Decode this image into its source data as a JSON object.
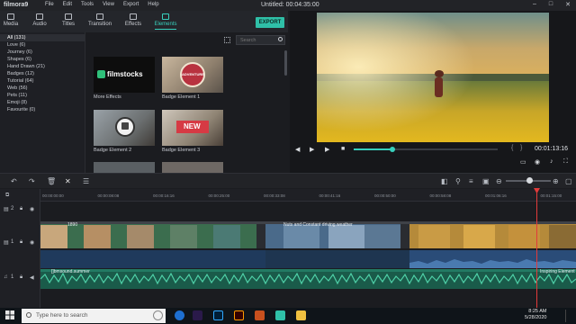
{
  "app": {
    "name": "filmora9",
    "title": "Untitled: 00:04:35:00",
    "menu": [
      "File",
      "Edit",
      "Tools",
      "View",
      "Export",
      "Help"
    ]
  },
  "tabs": [
    "Media",
    "Audio",
    "Titles",
    "Transition",
    "Effects",
    "Elements"
  ],
  "export_label": "EXPORT",
  "categories": [
    "All (131)",
    "Love (6)",
    "Journey (6)",
    "Shapes (6)",
    "Hand Drawn (21)",
    "Badges (12)",
    "Tutorial (64)",
    "Web (56)",
    "Pets (11)",
    "Emoji (8)",
    "Favourite (0)"
  ],
  "search": {
    "placeholder": "Search"
  },
  "elements": [
    {
      "label": "More Effects",
      "thumb_text": "filmstocks"
    },
    {
      "label": "Badge Element 1",
      "thumb_text": "ADVENTURE"
    },
    {
      "label": "Badge Element 2",
      "thumb_text": ""
    },
    {
      "label": "Badge Element 3",
      "thumb_text": "NEW"
    }
  ],
  "preview": {
    "timecode": "00:01:13:16",
    "progress": 0.27
  },
  "ruler_ticks": [
    "00:00:00:00",
    "00:00:08:08",
    "00:00:16:16",
    "00:00:25:00",
    "00:00:33:08",
    "00:00:41:16",
    "00:00:50:00",
    "00:00:58:08",
    "00:01:06:16",
    "00:01:15:00"
  ],
  "track_labels": {
    "video2": "2",
    "video1": "1",
    "audio": "1"
  },
  "clips": {
    "v2_label": "1890",
    "v2_mid_label": "Nuts and Constant driving weather",
    "audio_label": "[]bmsound.summer",
    "audio_right_label": "Inspiring Element"
  },
  "taskbar": {
    "search_placeholder": "Type here to search",
    "time": "8:25 AM",
    "date": "5/28/2020"
  },
  "colors": {
    "accent": "#38d0bd",
    "playhead": "#e23b3b"
  }
}
